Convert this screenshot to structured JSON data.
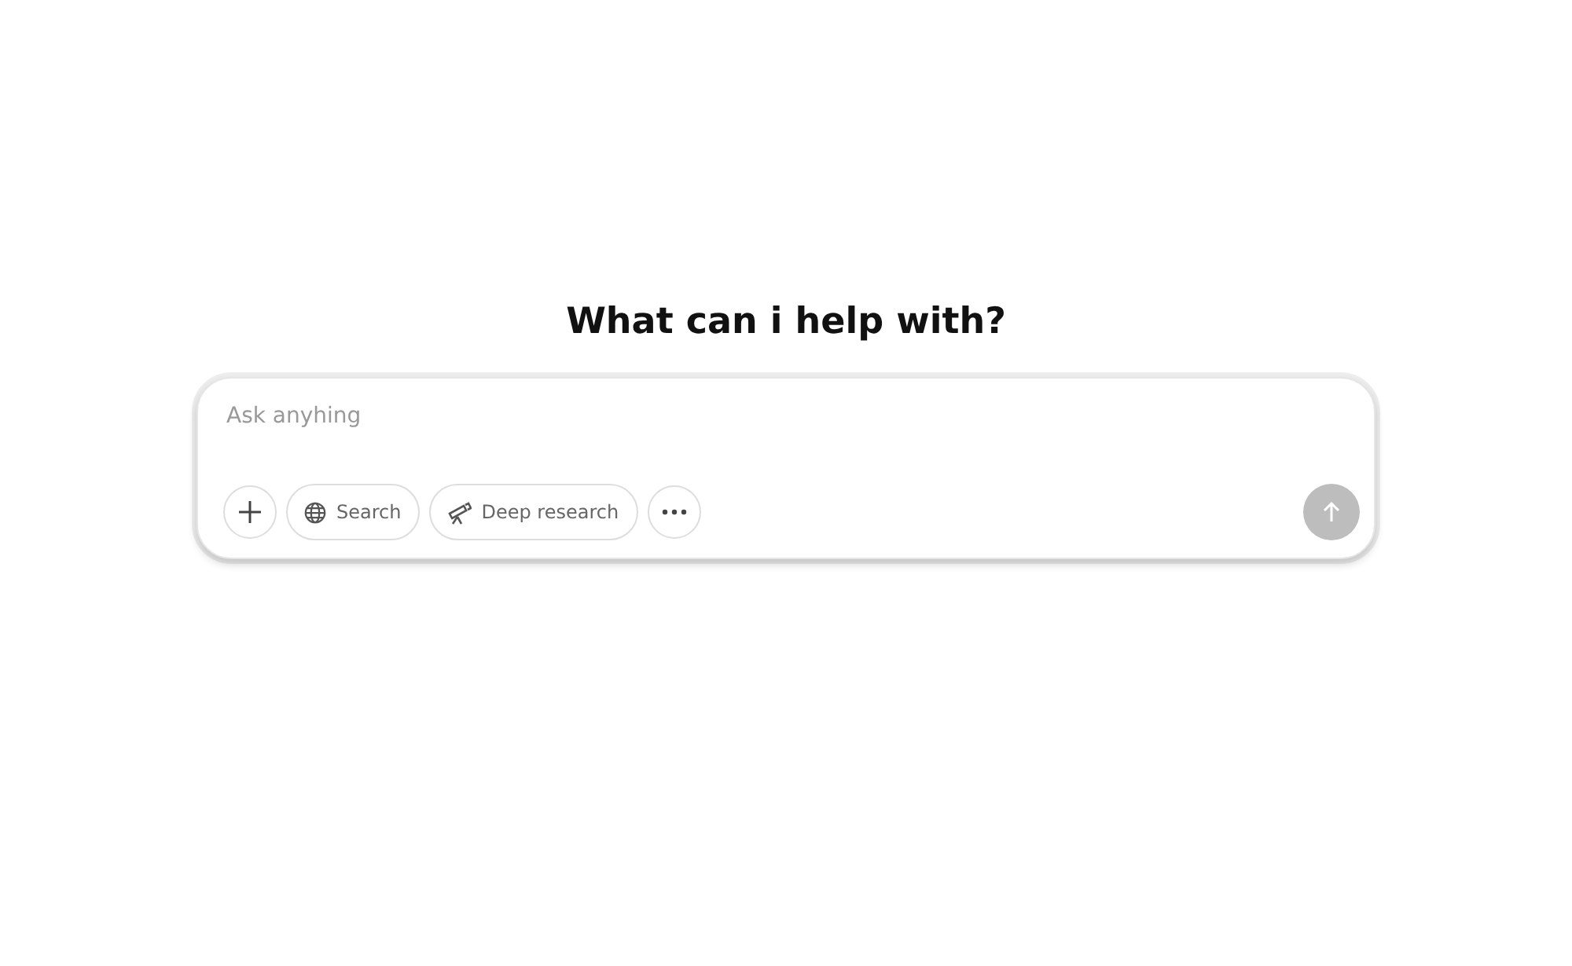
{
  "heading": "What can i help with?",
  "composer": {
    "placeholder": "Ask anyhing",
    "tools": [
      {
        "kind": "add"
      },
      {
        "kind": "search",
        "label": "Search"
      },
      {
        "kind": "research",
        "label": "Deep research"
      },
      {
        "kind": "more"
      }
    ],
    "send": {
      "disabled": true
    }
  }
}
